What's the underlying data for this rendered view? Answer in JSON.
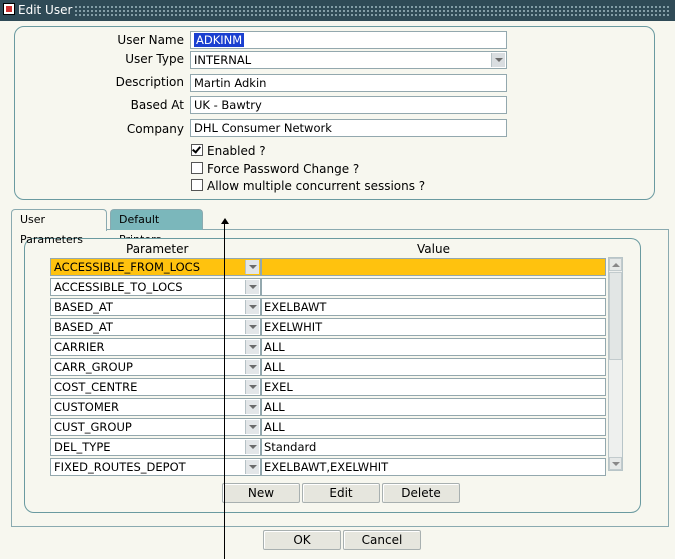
{
  "window": {
    "title": "Edit User"
  },
  "form": {
    "user_name_label": "User Name",
    "user_name_value": "ADKINM",
    "user_type_label": "User Type",
    "user_type_value": "INTERNAL",
    "description_label": "Description",
    "description_value": "Martin Adkin",
    "based_at_label": "Based At",
    "based_at_value": "UK - Bawtry",
    "company_label": "Company",
    "company_value": "DHL Consumer Network",
    "enabled_label": "Enabled ?",
    "enabled_checked": true,
    "force_pw_label": "Force Password Change ?",
    "force_pw_checked": false,
    "multi_session_label": "Allow multiple concurrent sessions ?",
    "multi_session_checked": false
  },
  "tabs": [
    {
      "label": "User Parameters",
      "active": true
    },
    {
      "label": "Default Printers",
      "active": false
    }
  ],
  "grid": {
    "param_header": "Parameter",
    "value_header": "Value",
    "rows": [
      {
        "param": "ACCESSIBLE_FROM_LOCS",
        "value": ""
      },
      {
        "param": "ACCESSIBLE_TO_LOCS",
        "value": ""
      },
      {
        "param": "BASED_AT",
        "value": "EXELBAWT"
      },
      {
        "param": "BASED_AT",
        "value": "EXELWHIT"
      },
      {
        "param": "CARRIER",
        "value": "ALL"
      },
      {
        "param": "CARR_GROUP",
        "value": "ALL"
      },
      {
        "param": "COST_CENTRE",
        "value": "EXEL"
      },
      {
        "param": "CUSTOMER",
        "value": "ALL"
      },
      {
        "param": "CUST_GROUP",
        "value": "ALL"
      },
      {
        "param": "DEL_TYPE",
        "value": "Standard"
      },
      {
        "param": "FIXED_ROUTES_DEPOT",
        "value": "EXELBAWT,EXELWHIT"
      }
    ]
  },
  "buttons": {
    "new": "New",
    "edit": "Edit",
    "delete": "Delete",
    "ok": "OK",
    "cancel": "Cancel"
  },
  "colors": {
    "titlebar": "#2f4a56",
    "current_row": "#ffc20e",
    "active_tab": "#f7f7ef",
    "inactive_tab": "#7bb7bb",
    "selection": "#1a3fd0"
  }
}
